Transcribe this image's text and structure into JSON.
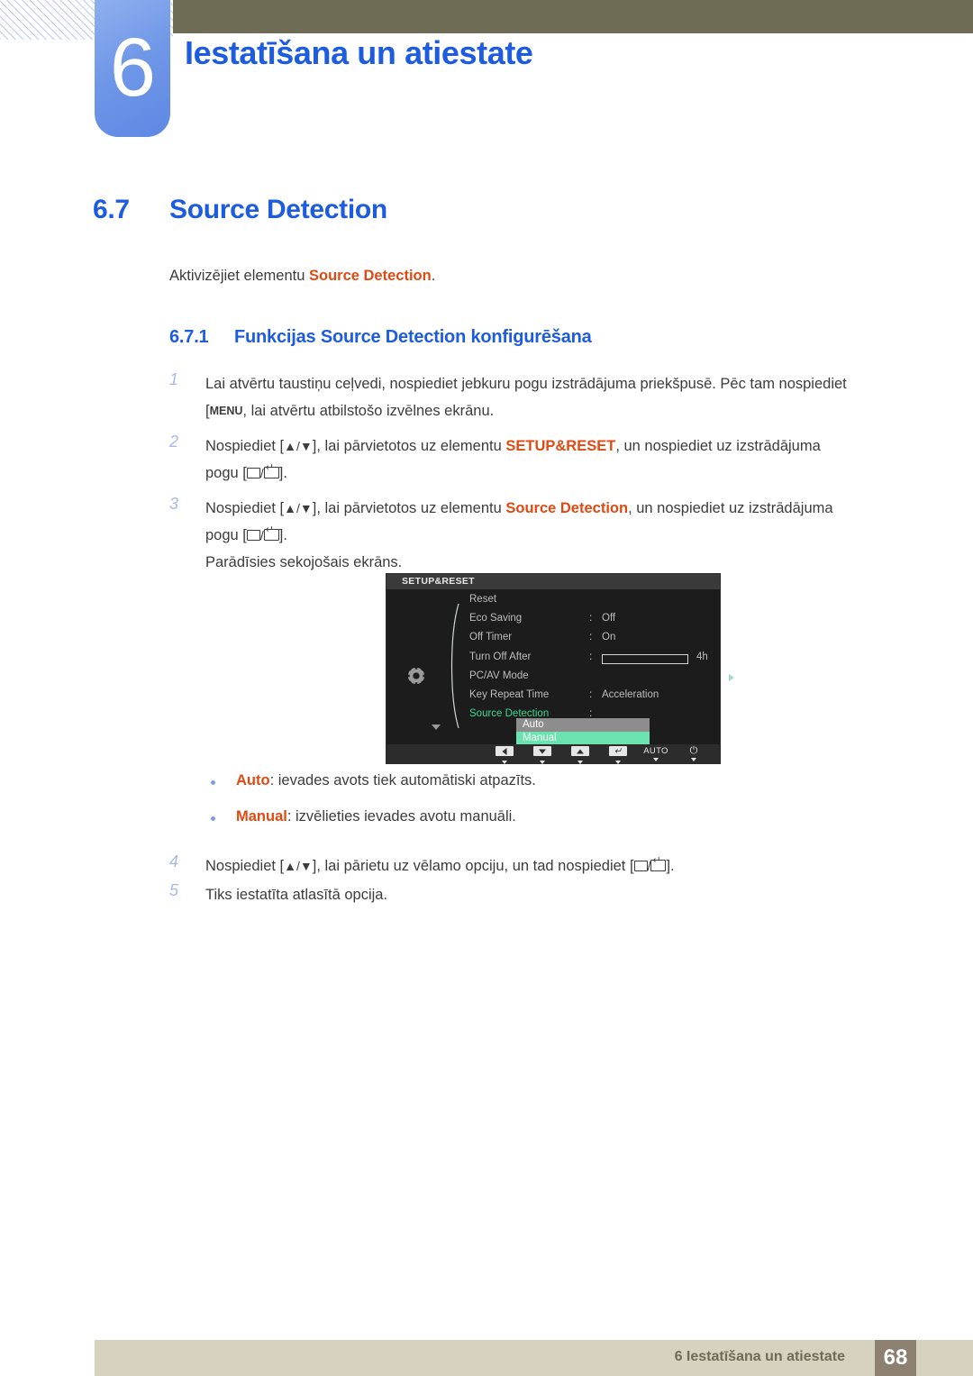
{
  "chapter": {
    "number": "6",
    "title": "Iestatīšana un atiestate"
  },
  "section": {
    "number": "6.7",
    "title": "Source Detection",
    "lead_prefix": "Aktivizējiet elementu ",
    "lead_highlight": "Source Detection",
    "lead_suffix": ".",
    "subsection_number": "6.7.1",
    "subsection_title": "Funkcijas Source Detection konfigurēšana"
  },
  "steps": [
    {
      "index": "1",
      "text_a": "Lai atvērtu taustiņu ceļvedi, nospiediet jebkuru pogu izstrādājuma priekšpusē. Pēc tam nospiediet",
      "keycap": "MENU",
      "text_b": ", lai atvērtu atbilstošo izvēlnes ekrānu."
    },
    {
      "index": "2",
      "text_a": "Nospiediet [",
      "arrows": "▲/▼",
      "text_b": "], lai pārvietotos uz elementu ",
      "highlight": "SETUP&RESET",
      "text_c": ", un nospiediet uz izstrādājuma",
      "text_d": "pogu [",
      "text_e": "]."
    },
    {
      "index": "3",
      "text_a": "Nospiediet [",
      "arrows": "▲/▼",
      "text_b": "], lai pārvietotos uz elementu ",
      "highlight": "Source Detection",
      "text_c": ", un nospiediet uz izstrādājuma",
      "text_d": "pogu [",
      "text_e": "].",
      "note": "Parādīsies sekojošais ekrāns."
    }
  ],
  "steps_after": [
    {
      "index": "4",
      "text_a": "Nospiediet [",
      "arrows": "▲/▼",
      "text_b": "], lai pārietu uz vēlamo opciju, un tad nospiediet [",
      "text_c": "]."
    },
    {
      "index": "5",
      "text_a": "Tiks iestatīta atlasītā opcija."
    }
  ],
  "osd": {
    "title": "SETUP&RESET",
    "gear_icon": "gear-icon",
    "rows": [
      {
        "label": "Reset",
        "colon": "",
        "value": ""
      },
      {
        "label": "Eco Saving",
        "colon": ":",
        "value": "Off"
      },
      {
        "label": "Off Timer",
        "colon": ":",
        "value": "On"
      },
      {
        "label": "Turn Off After",
        "colon": ":",
        "value": "4h",
        "slider": true,
        "slider_pct": 18
      },
      {
        "label": "PC/AV Mode",
        "colon": "",
        "value": "",
        "submenu_arrow": true
      },
      {
        "label": "Key Repeat Time",
        "colon": ":",
        "value": "Acceleration"
      },
      {
        "label": "Source Detection",
        "colon": ":",
        "value": "",
        "active": true,
        "popup": true
      }
    ],
    "popup_options": [
      "Auto",
      "Manual"
    ],
    "popup_selected": "Manual",
    "buttons": [
      {
        "name": "left-button",
        "glyph": "◀",
        "type": "cap-left"
      },
      {
        "name": "down-button",
        "glyph": "▼",
        "type": "cap-down"
      },
      {
        "name": "up-button",
        "glyph": "▲",
        "type": "cap-up"
      },
      {
        "name": "enter-button",
        "glyph": "↵",
        "type": "cap-enter"
      },
      {
        "name": "auto-button",
        "glyph": "AUTO",
        "type": "text"
      },
      {
        "name": "power-button",
        "glyph": "⏻",
        "type": "power"
      }
    ]
  },
  "bullets": [
    {
      "term": "Auto",
      "desc": ": ievades avots tiek automātiski atpazīts."
    },
    {
      "term": "Manual",
      "desc": ": izvēlieties ievades avotu manuāli."
    }
  ],
  "footer": {
    "text": "6 Iestatīšana un atiestate",
    "page": "68"
  },
  "colors": {
    "heading_blue": "#1d5ce0",
    "highlight_orange": "#e04a12",
    "olive": "#6f6c56",
    "footer_beige": "#d6d2bf",
    "page_box": "#8d8070",
    "osd_green": "#3ad88f",
    "osd_select": "#6ae3ae"
  }
}
